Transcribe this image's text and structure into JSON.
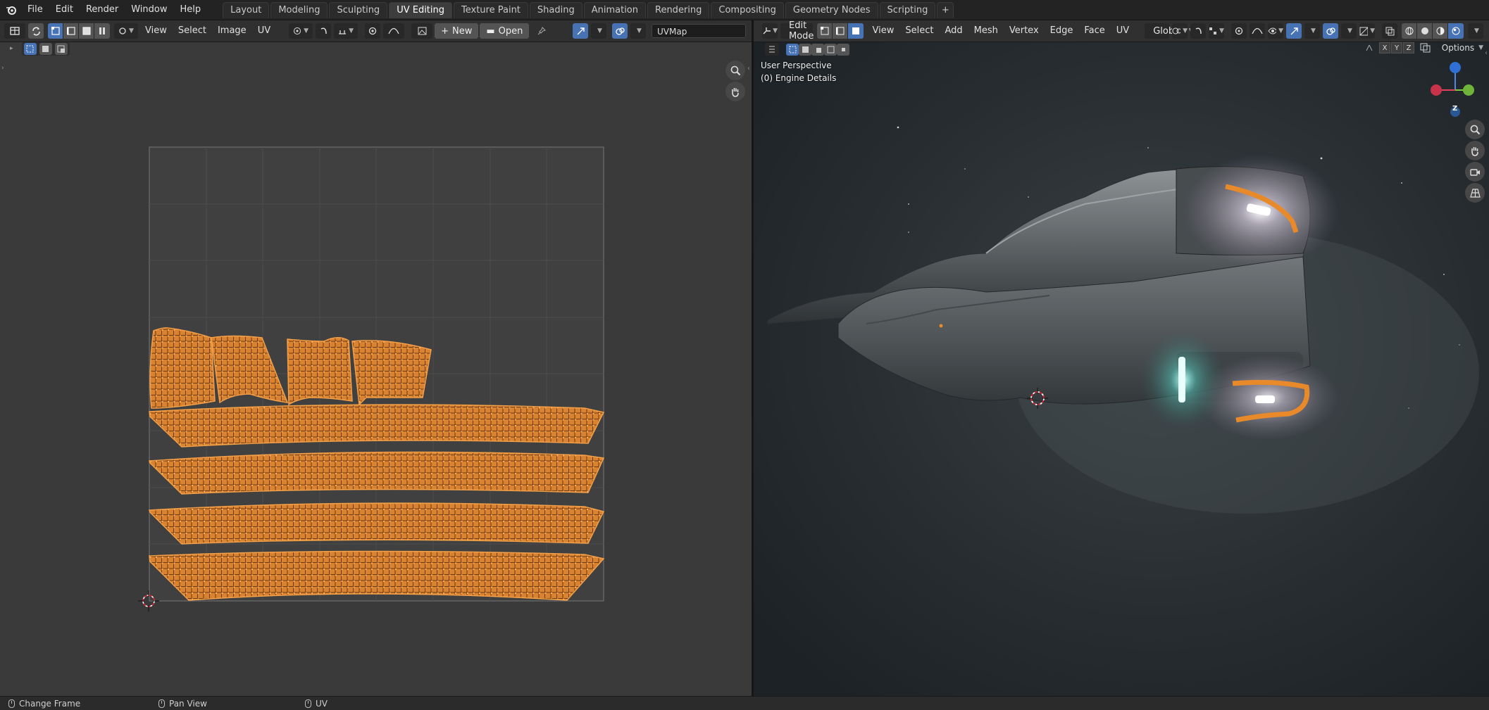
{
  "menu": [
    "File",
    "Edit",
    "Render",
    "Window",
    "Help"
  ],
  "workspace_tabs": [
    {
      "label": "Layout",
      "active": false
    },
    {
      "label": "Modeling",
      "active": false
    },
    {
      "label": "Sculpting",
      "active": false
    },
    {
      "label": "UV Editing",
      "active": true
    },
    {
      "label": "Texture Paint",
      "active": false
    },
    {
      "label": "Shading",
      "active": false
    },
    {
      "label": "Animation",
      "active": false
    },
    {
      "label": "Rendering",
      "active": false
    },
    {
      "label": "Compositing",
      "active": false
    },
    {
      "label": "Geometry Nodes",
      "active": false
    },
    {
      "label": "Scripting",
      "active": false
    }
  ],
  "uv_header": {
    "menus": [
      "View",
      "Select",
      "Image",
      "UV"
    ],
    "new_label": "New",
    "open_label": "Open",
    "uvmap_value": "UVMap"
  },
  "viewport_header": {
    "mode": "Edit Mode",
    "menus": [
      "View",
      "Select",
      "Add",
      "Mesh",
      "Vertex",
      "Edge",
      "Face",
      "UV"
    ],
    "transform_orientation": "Global",
    "options_label": "Options",
    "axis_buttons": [
      "X",
      "Y",
      "Z"
    ]
  },
  "viewport_overlay": {
    "perspective": "User Perspective",
    "object": "(0) Engine Details"
  },
  "gizmo": {
    "z": "Z"
  },
  "status": {
    "left": "Change Frame",
    "middle": "Pan View",
    "right": "UV"
  },
  "colors": {
    "selection": "#f08a24",
    "active_tab": "#3d3d3d",
    "accent_blue": "#4772b3",
    "uv_background": "#3a3a3a"
  }
}
